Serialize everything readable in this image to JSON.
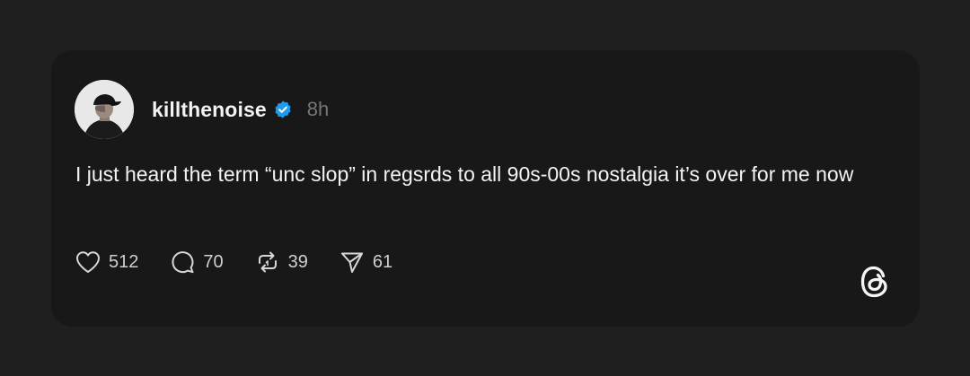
{
  "post": {
    "username": "killthenoise",
    "time_ago": "8h",
    "text": "I just heard the term “unc slop” in regsrds to all 90s-00s nostalgia it’s over for me now",
    "likes": "512",
    "replies": "70",
    "reposts": "39",
    "shares": "61"
  },
  "icons": {
    "verified": "verified-badge-icon",
    "like": "heart-icon",
    "reply": "speech-bubble-icon",
    "repost": "repost-icon",
    "share": "send-icon",
    "brand": "threads-logo-icon"
  },
  "colors": {
    "background": "#1f1f1f",
    "card": "#181818",
    "text": "#f3f3f3",
    "muted": "#777777",
    "verified": "#1d9bf0"
  }
}
